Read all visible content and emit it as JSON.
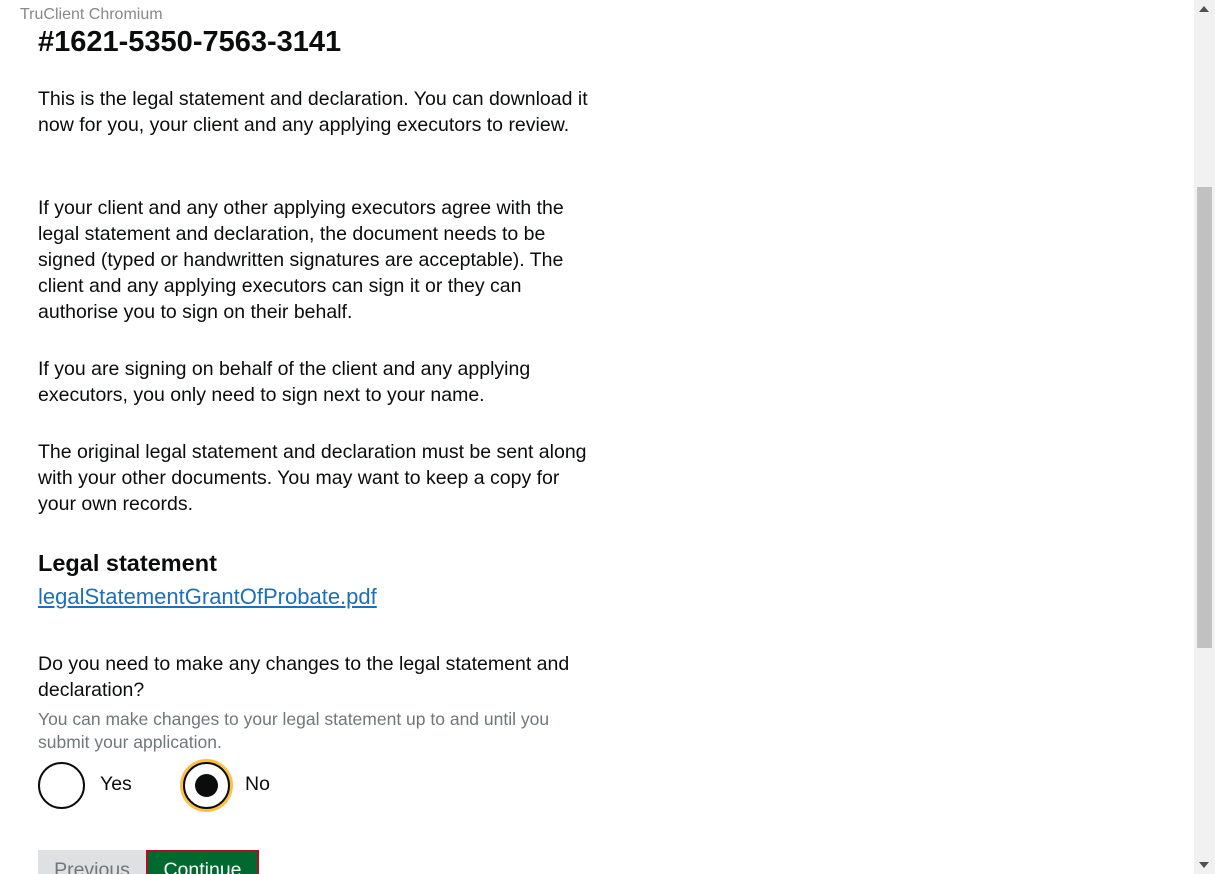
{
  "browser": {
    "label": "TruClient Chromium"
  },
  "page": {
    "case_number": "#1621-5350-7563-3141",
    "paragraphs": [
      "This is the legal statement and declaration. You can download it now for you, your client and any applying executors to review.",
      "If your client and any other applying executors agree with the legal statement and declaration, the document needs to be signed (typed or handwritten signatures are acceptable). The client and any applying executors can sign it or they can authorise you to sign on their behalf.",
      "If you are signing on behalf of the client and any applying executors, you only need to sign next to your name.",
      "The original legal statement and declaration must be sent along with your other documents. You may want to keep a copy for your own records."
    ],
    "legal_statement_heading": "Legal statement",
    "legal_statement_file": "legalStatementGrantOfProbate.pdf",
    "question": "Do you need to make any changes to the legal statement and declaration?",
    "hint": "You can make changes to your legal statement up to and until you submit your application.",
    "options": {
      "yes_label": "Yes",
      "no_label": "No",
      "selected": "No"
    },
    "buttons": {
      "previous_label": "Previous",
      "continue_label": "Continue"
    }
  },
  "colors": {
    "link": "#1d70b8",
    "continue_button": "#00692f",
    "focus_ring": "#ffbf47",
    "hint_text": "#6f777b"
  },
  "icons": {
    "scroll_up": "scroll-up-arrow-icon",
    "scroll_down": "scroll-down-arrow-icon"
  }
}
